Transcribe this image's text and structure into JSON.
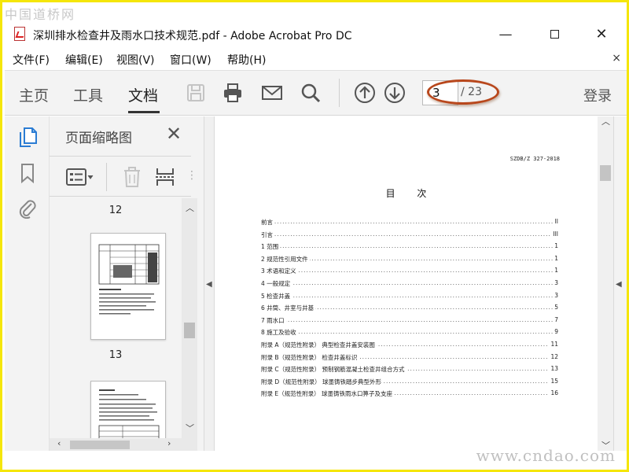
{
  "watermark": {
    "top": "中国道桥网",
    "bottom": "www.cndao.com"
  },
  "window": {
    "title": "深圳排水检查井及雨水口技术规范.pdf - Adobe Acrobat Pro DC",
    "minimize": "—",
    "close": "✕"
  },
  "menu": {
    "items": [
      "文件(F)",
      "编辑(E)",
      "视图(V)",
      "窗口(W)",
      "帮助(H)"
    ],
    "close": "×"
  },
  "toolbar": {
    "tabs": [
      "主页",
      "工具",
      "文档"
    ],
    "active_tab": "文档",
    "page_current": "3",
    "page_total": "/ 23",
    "signin": "登录",
    "icons": [
      "save-icon",
      "print-icon",
      "email-icon",
      "search-icon",
      "page-up-icon",
      "page-down-icon"
    ]
  },
  "panel": {
    "title": "页面缩略图",
    "close": "✕",
    "thumb_labels": [
      "12",
      "13"
    ]
  },
  "document": {
    "header": "SZDB/Z 327-2018",
    "title": "目 次",
    "toc": [
      {
        "label": "前言",
        "page": "II"
      },
      {
        "label": "引言",
        "page": "III"
      },
      {
        "label": "1  范围",
        "page": "1"
      },
      {
        "label": "2  规范性引用文件",
        "page": "1"
      },
      {
        "label": "3  术语和定义",
        "page": "1"
      },
      {
        "label": "4  一般规定",
        "page": "3"
      },
      {
        "label": "5  检查井盖",
        "page": "3"
      },
      {
        "label": "6  井筒、井室与井基",
        "page": "5"
      },
      {
        "label": "7  雨水口",
        "page": "7"
      },
      {
        "label": "8  施工及验收",
        "page": "9"
      },
      {
        "label": "附录 A（规范性附录）  典型检查井盖安装图",
        "page": "11"
      },
      {
        "label": "附录 B（规范性附录）  检查井盖标识",
        "page": "12"
      },
      {
        "label": "附录 C（规范性附录）  预制钢筋混凝土检查井组合方式",
        "page": "13"
      },
      {
        "label": "附录 D（规范性附录）  球墨铸铁踏步典型外形",
        "page": "15"
      },
      {
        "label": "附录 E（规范性附录）  球墨铸铁雨水口箅子及支座",
        "page": "16"
      }
    ]
  },
  "colors": {
    "accent_blue": "#2b7cd3",
    "annotation": "#b8471c",
    "frame": "#f5e60a"
  }
}
